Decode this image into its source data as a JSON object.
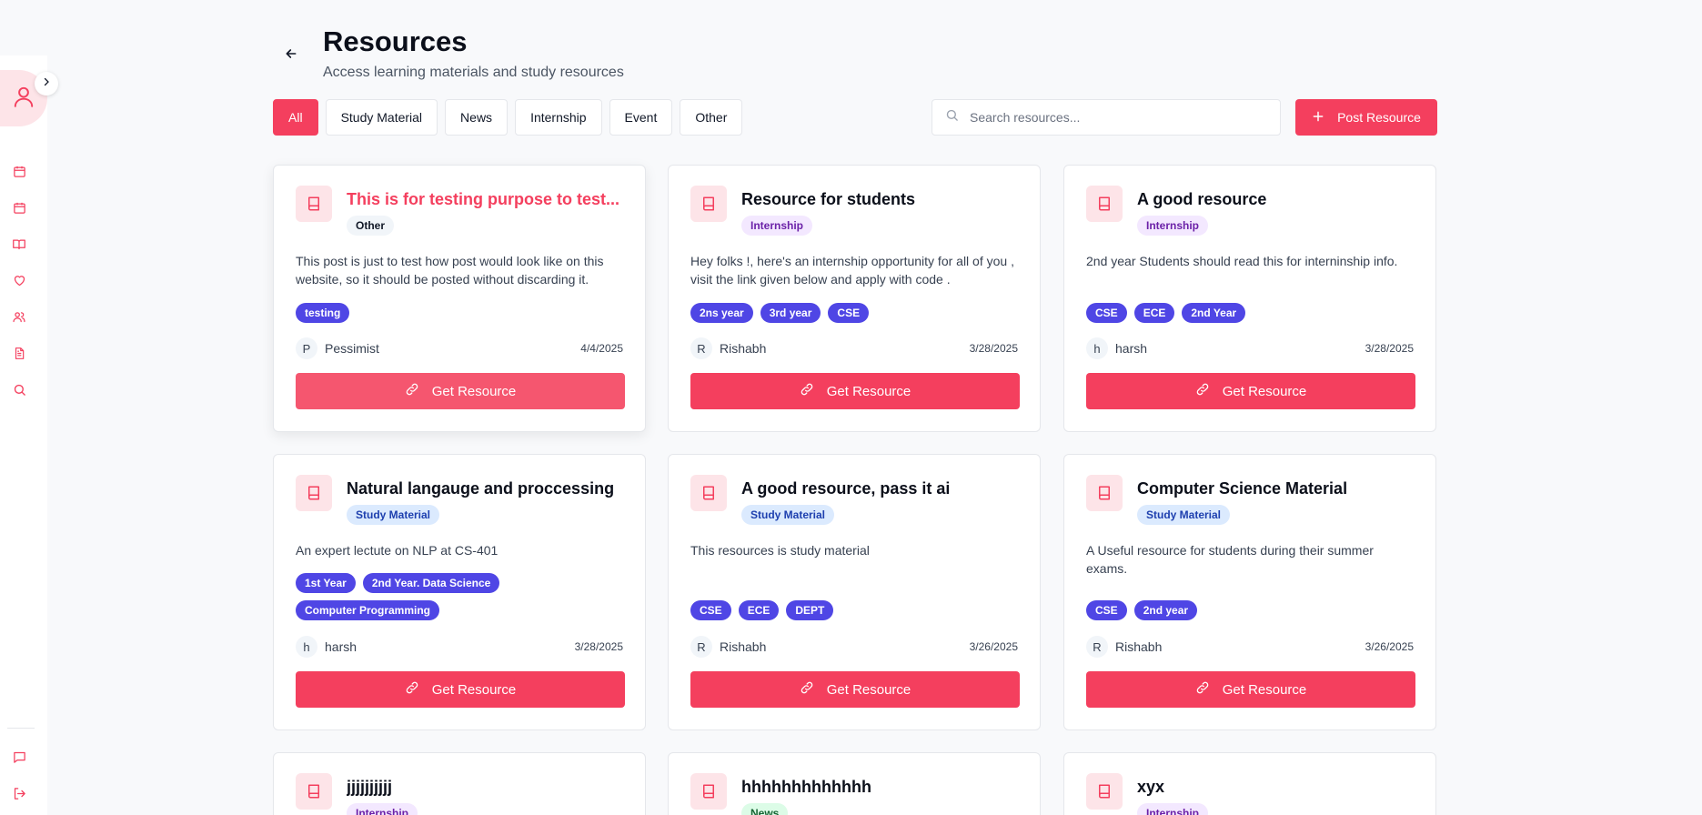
{
  "header": {
    "title": "Resources",
    "subtitle": "Access learning materials and study resources"
  },
  "filters": [
    "All",
    "Study Material",
    "News",
    "Internship",
    "Event",
    "Other"
  ],
  "active_filter": "All",
  "search": {
    "placeholder": "Search resources...",
    "value": ""
  },
  "post_button": "Post Resource",
  "get_resource_label": "Get Resource",
  "sidebar": {
    "icons": [
      "user-icon",
      "calendar-icon",
      "calendar-icon",
      "book-open-icon",
      "heart-icon",
      "users-icon",
      "file-text-icon",
      "search-icon",
      "message-icon",
      "logout-icon"
    ]
  },
  "colors": {
    "accent": "#f43f5e",
    "tag": "#4f46e5"
  },
  "cards": [
    {
      "title": "This is for testing purpose to test...",
      "category": "Other",
      "description": "This post is just to test how post would look like on this website, so it should be posted without discarding it.",
      "tags": [
        "testing"
      ],
      "author_initial": "P",
      "author": "Pessimist",
      "date": "4/4/2025"
    },
    {
      "title": "Resource for students",
      "category": "Internship",
      "description": "Hey folks !, here's an internship opportunity for all of you , visit the link given below and apply with code .",
      "tags": [
        "2ns year",
        "3rd year",
        "CSE"
      ],
      "author_initial": "R",
      "author": "Rishabh",
      "date": "3/28/2025"
    },
    {
      "title": "A good resource",
      "category": "Internship",
      "description": "2nd year Students should read this for interninship info.",
      "tags": [
        "CSE",
        "ECE",
        "2nd Year"
      ],
      "author_initial": "h",
      "author": "harsh",
      "date": "3/28/2025"
    },
    {
      "title": "Natural langauge and proccessing",
      "category": "Study Material",
      "description": "An expert lectute on NLP at CS-401",
      "tags": [
        "1st Year",
        "2nd Year. Data Science",
        "Computer Programming"
      ],
      "author_initial": "h",
      "author": "harsh",
      "date": "3/28/2025"
    },
    {
      "title": "A good resource, pass it ai",
      "category": "Study Material",
      "description": "This resources is study material",
      "tags": [
        "CSE",
        "ECE",
        "DEPT"
      ],
      "author_initial": "R",
      "author": "Rishabh",
      "date": "3/26/2025"
    },
    {
      "title": "Computer Science Material",
      "category": "Study Material",
      "description": "A Useful resource for students during their summer exams.",
      "tags": [
        "CSE",
        "2nd year"
      ],
      "author_initial": "R",
      "author": "Rishabh",
      "date": "3/26/2025"
    },
    {
      "title": "jjjjjjjjjj",
      "category": "Internship"
    },
    {
      "title": "hhhhhhhhhhhhh",
      "category": "News"
    },
    {
      "title": "xyx",
      "category": "Internship"
    }
  ]
}
